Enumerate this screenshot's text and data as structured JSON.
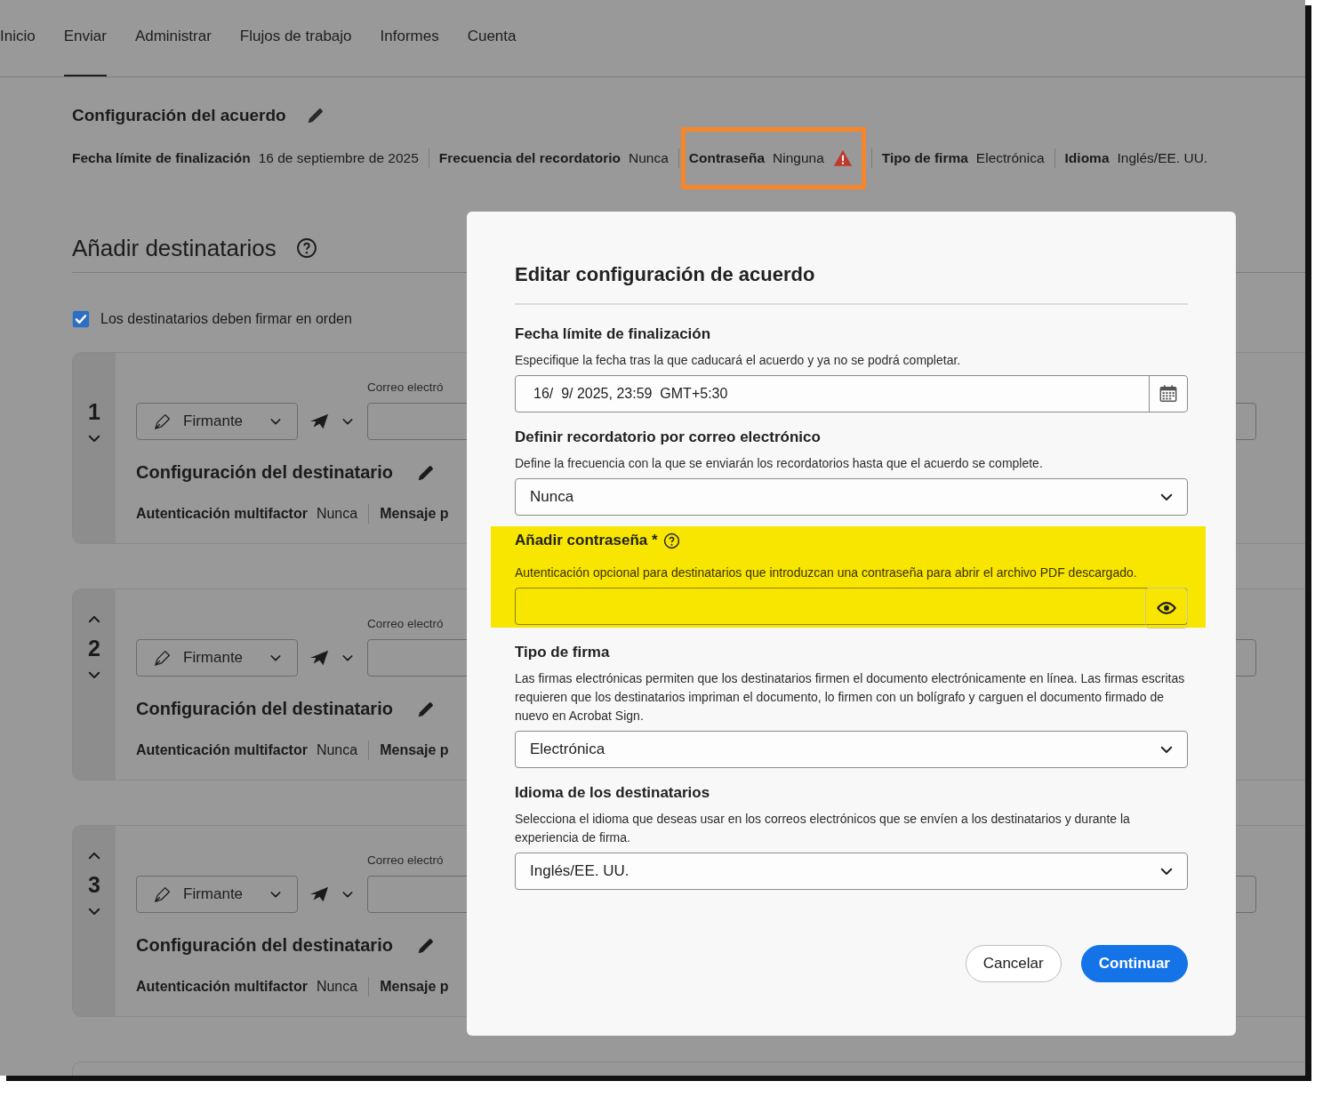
{
  "nav": {
    "tabs": [
      {
        "label": "Inicio",
        "selected": false
      },
      {
        "label": "Enviar",
        "selected": true
      },
      {
        "label": "Administrar",
        "selected": false
      },
      {
        "label": "Flujos de trabajo",
        "selected": false
      },
      {
        "label": "Informes",
        "selected": false
      },
      {
        "label": "Cuenta",
        "selected": false
      }
    ]
  },
  "agreement": {
    "title": "Configuración del acuerdo",
    "items": [
      {
        "label": "Fecha límite de finalización",
        "value": "16 de septiembre de 2025",
        "warning": false,
        "highlighted": false
      },
      {
        "label": "Frecuencia del recordatorio",
        "value": "Nunca",
        "warning": false,
        "highlighted": false
      },
      {
        "label": "Contraseña",
        "value": "Ninguna",
        "warning": true,
        "highlighted": true
      },
      {
        "label": "Tipo de firma",
        "value": "Electrónica",
        "warning": false,
        "highlighted": false
      },
      {
        "label": "Idioma",
        "value": "Inglés/EE. UU.",
        "warning": false,
        "highlighted": false
      }
    ]
  },
  "recipients": {
    "title": "Añadir destinatarios",
    "in_order": {
      "label": "Los destinatarios deben firmar en orden",
      "checked": true
    },
    "cards": [
      {
        "number": "1",
        "can_move_up": false,
        "can_move_down": true,
        "role": "Firmante",
        "email_label": "Correo electró",
        "settings_title": "Configuración del destinatario",
        "mfa_label": "Autenticación multifactor",
        "mfa_value": "Nunca",
        "message_label": "Mensaje p"
      },
      {
        "number": "2",
        "can_move_up": true,
        "can_move_down": true,
        "role": "Firmante",
        "email_label": "Correo electró",
        "settings_title": "Configuración del destinatario",
        "mfa_label": "Autenticación multifactor",
        "mfa_value": "Nunca",
        "message_label": "Mensaje p"
      },
      {
        "number": "3",
        "can_move_up": true,
        "can_move_down": true,
        "role": "Firmante",
        "email_label": "Correo electró",
        "settings_title": "Configuración del destinatario",
        "mfa_label": "Autenticación multifactor",
        "mfa_value": "Nunca",
        "message_label": "Mensaje p"
      }
    ]
  },
  "dialog": {
    "title": "Editar configuración de acuerdo",
    "sections": [
      {
        "kind": "date",
        "label": "Fecha límite de finalización",
        "description": "Especifique la fecha tras la que caducará el acuerdo y ya no se podrá completar.",
        "value": "16/  9/ 2025, 23:59  GMT+5:30",
        "help": false,
        "highlighted": false
      },
      {
        "kind": "select",
        "label": "Definir recordatorio por correo electrónico",
        "description": "Define la frecuencia con la que se enviarán los recordatorios hasta que el acuerdo se complete.",
        "value": "Nunca",
        "help": false,
        "highlighted": false
      },
      {
        "kind": "password",
        "label": "Añadir contraseña *",
        "description": "Autenticación opcional para destinatarios que introduzcan una contraseña para abrir el archivo PDF descargado.",
        "help": true,
        "highlighted": true
      },
      {
        "kind": "select",
        "label": "Tipo de firma",
        "description": "Las firmas electrónicas permiten que los destinatarios firmen el documento electrónicamente en línea. Las firmas escritas requieren que los destinatarios impriman el documento, lo firmen con un bolígrafo y carguen el documento firmado de nuevo en Acrobat Sign.",
        "value": "Electrónica",
        "help": false,
        "highlighted": false
      },
      {
        "kind": "select",
        "label": "Idioma de los destinatarios",
        "description": "Selecciona el idioma que deseas usar en los correos electrónicos que se envíen a los destinatarios y durante la experiencia de firma.",
        "value": "Inglés/EE. UU.",
        "help": false,
        "highlighted": false
      }
    ],
    "buttons": [
      {
        "label": "Cancelar",
        "kind": "secondary"
      },
      {
        "label": "Continuar",
        "kind": "primary"
      }
    ]
  }
}
